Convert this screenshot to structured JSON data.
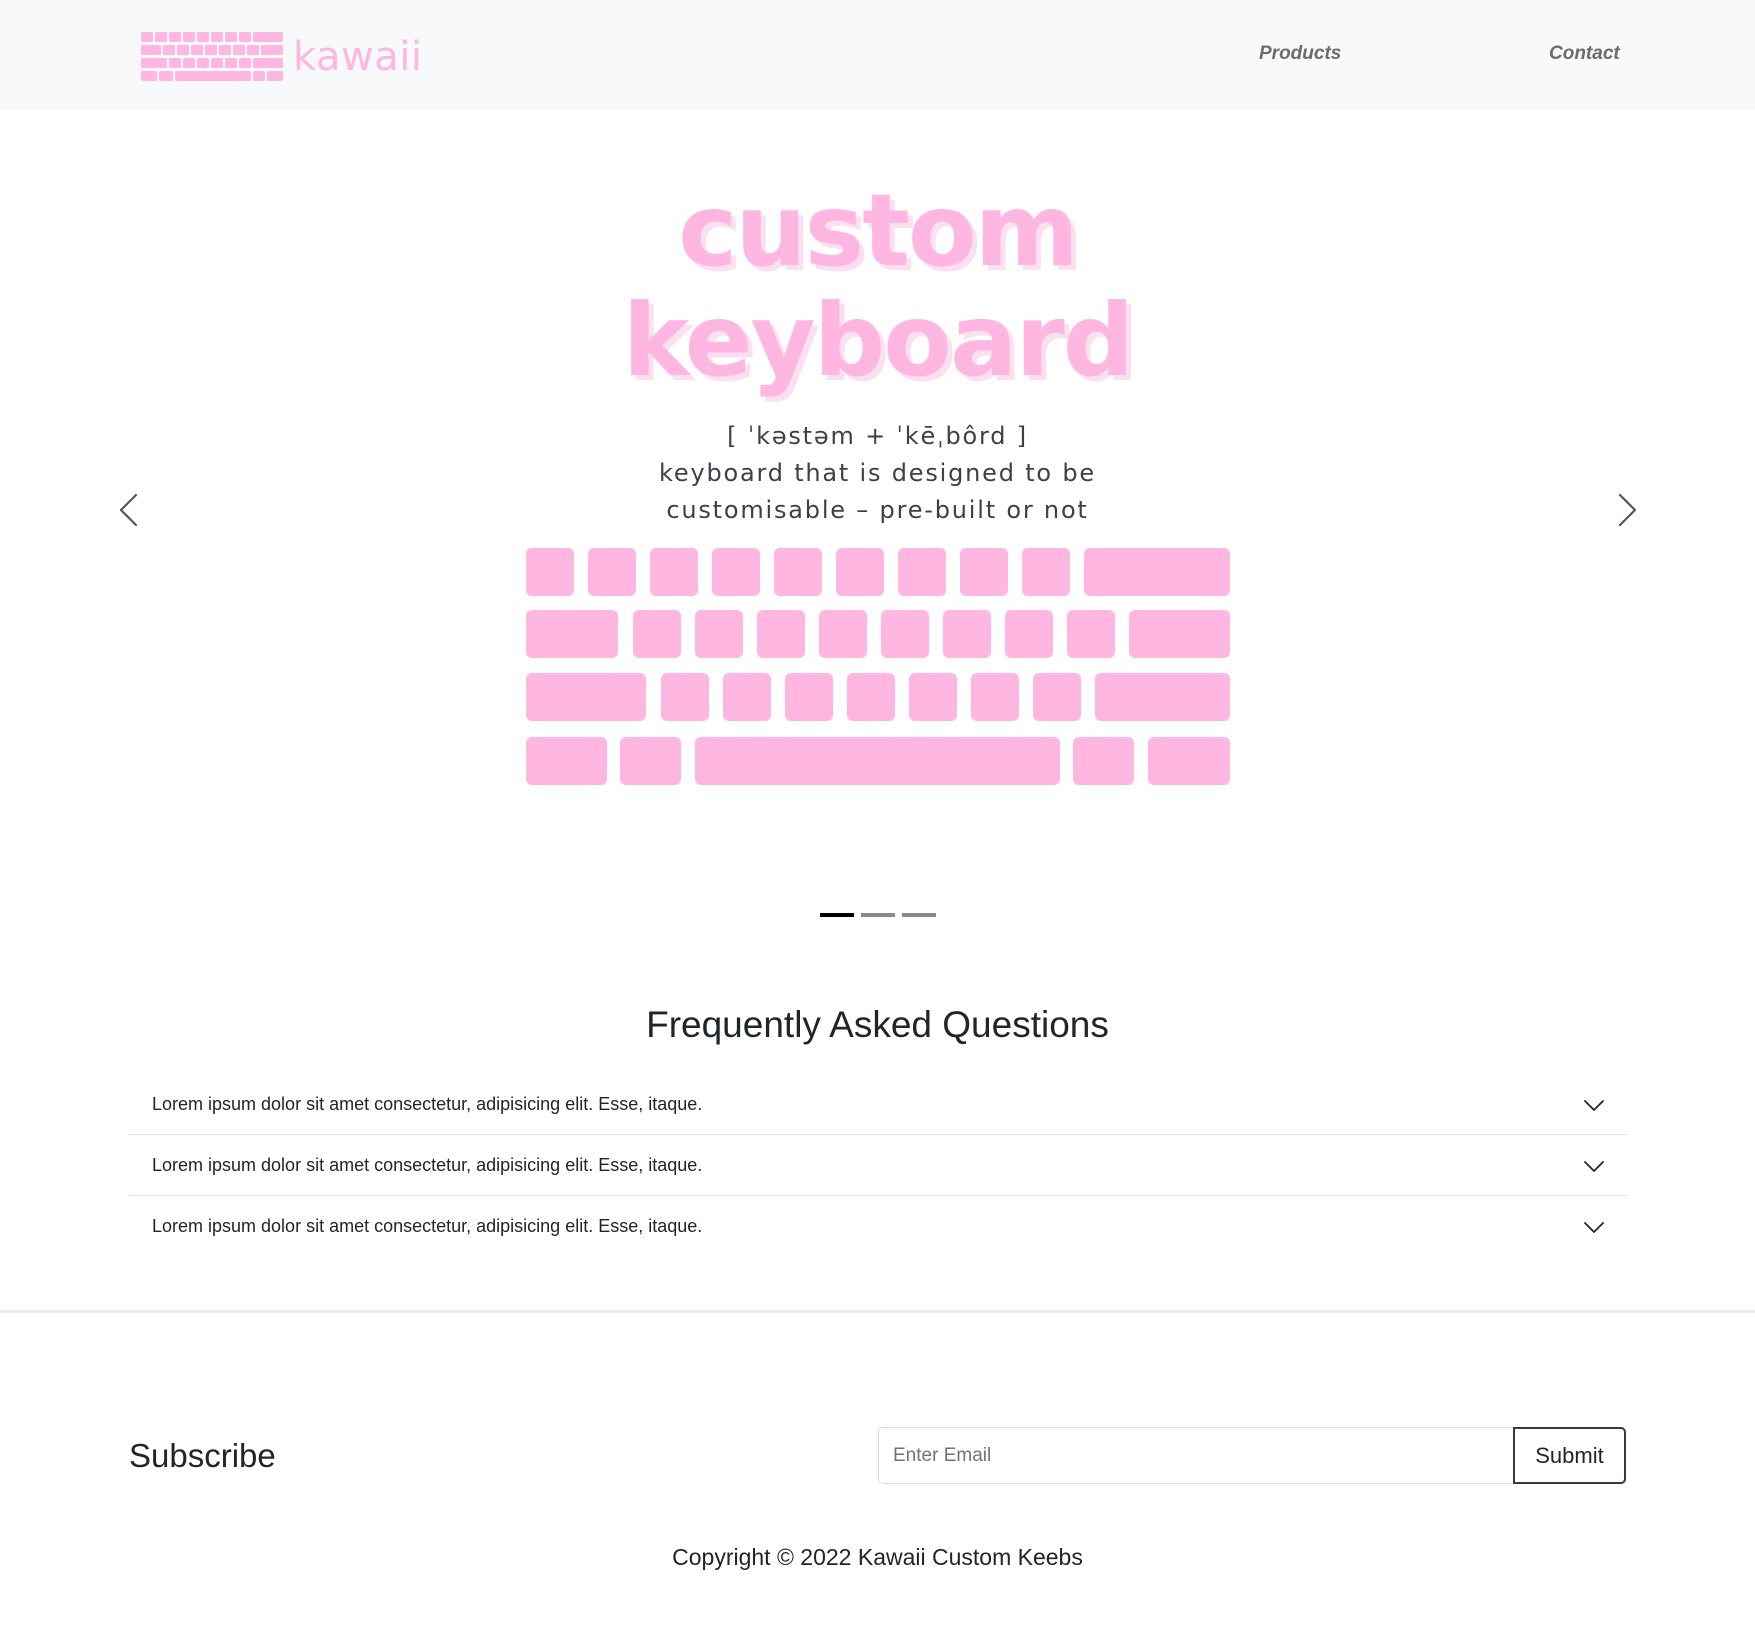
{
  "navbar": {
    "brand_text": "kawaii",
    "links": [
      {
        "label": "Products"
      },
      {
        "label": "Contact"
      }
    ]
  },
  "hero": {
    "title_line1": "custom",
    "title_line2": "keyboard",
    "pronunciation": "[ ˈkəstəm + ˈkēˌbôrd ]",
    "definition_line1": "keyboard that is designed to be",
    "definition_line2": "customisable – pre-built or not",
    "carousel": {
      "slide_count": 3,
      "active_slide": 1,
      "prev_icon": "chevron-left-icon",
      "next_icon": "chevron-right-icon"
    }
  },
  "faq": {
    "heading": "Frequently Asked Questions",
    "items": [
      {
        "question": "Lorem ipsum dolor sit amet consectetur, adipisicing elit. Esse, itaque."
      },
      {
        "question": "Lorem ipsum dolor sit amet consectetur, adipisicing elit. Esse, itaque."
      },
      {
        "question": "Lorem ipsum dolor sit amet consectetur, adipisicing elit. Esse, itaque."
      }
    ],
    "expand_icon": "chevron-down-icon"
  },
  "subscribe": {
    "title": "Subscribe",
    "email_placeholder": "Enter Email",
    "email_value": "",
    "submit_label": "Submit"
  },
  "footer": {
    "copyright": "Copyright © 2022 Kawaii Custom Keebs"
  },
  "colors": {
    "brand_pink": "#ffb6e1",
    "title_shadow_pink": "#fbe0f0",
    "navbar_bg": "#f8f9fa",
    "nav_link": "#6c6c6c",
    "text_dark": "#212529",
    "indicator_active": "#000000",
    "indicator_inactive": "#8a8a8a"
  }
}
